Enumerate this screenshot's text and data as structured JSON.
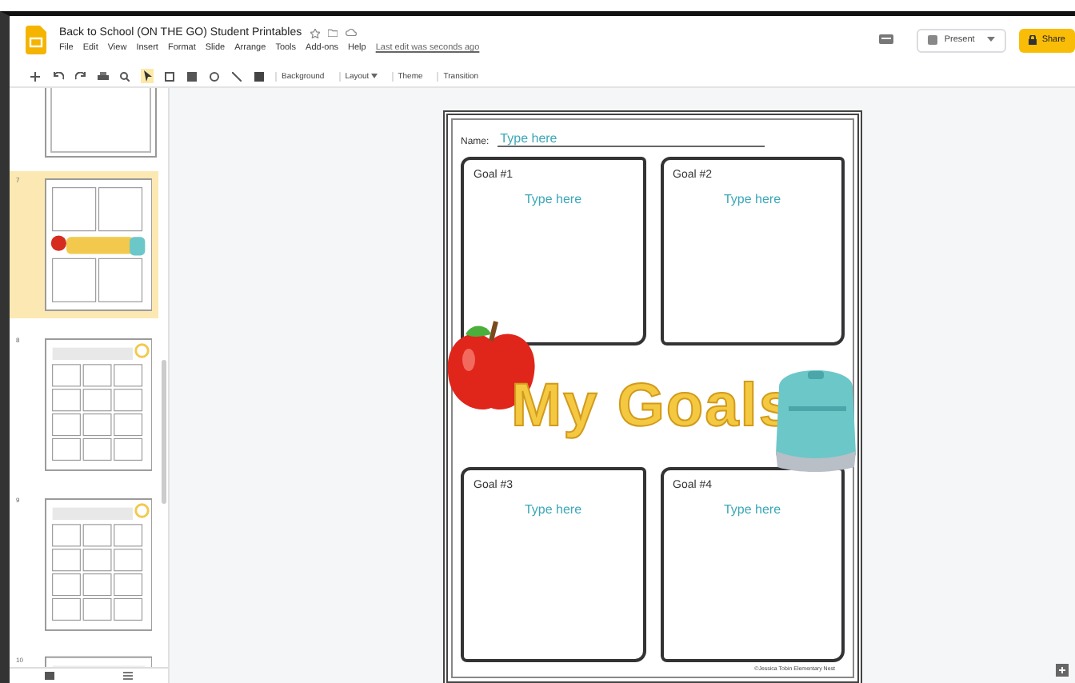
{
  "document": {
    "title": "Back to School (ON THE GO) Student Printables",
    "last_edit": "Last edit was seconds ago"
  },
  "menu": [
    "File",
    "Edit",
    "View",
    "Insert",
    "Format",
    "Slide",
    "Arrange",
    "Tools",
    "Add-ons",
    "Help"
  ],
  "toolbar": {
    "buttons": [
      {
        "label": "Background",
        "dropdown": false
      },
      {
        "label": "Layout",
        "dropdown": true
      },
      {
        "label": "Theme",
        "dropdown": false
      },
      {
        "label": "Transition",
        "dropdown": false
      }
    ]
  },
  "actions": {
    "present": "Present",
    "share": "Share"
  },
  "filmstrip": [
    {
      "number": "7",
      "kind": "goals",
      "selected": true
    },
    {
      "number": "8",
      "kind": "grid",
      "selected": false
    },
    {
      "number": "9",
      "kind": "grid",
      "selected": false
    },
    {
      "number": "10",
      "kind": "header",
      "selected": false
    }
  ],
  "slide": {
    "name_label": "Name:",
    "name_value": "Type here",
    "title": "My Goals",
    "goals": [
      {
        "label": "Goal #1",
        "value": "Type here"
      },
      {
        "label": "Goal #2",
        "value": "Type here"
      },
      {
        "label": "Goal #3",
        "value": "Type here"
      },
      {
        "label": "Goal #4",
        "value": "Type here"
      }
    ],
    "credit": "©Jessica Tobin Elementary Nest"
  }
}
